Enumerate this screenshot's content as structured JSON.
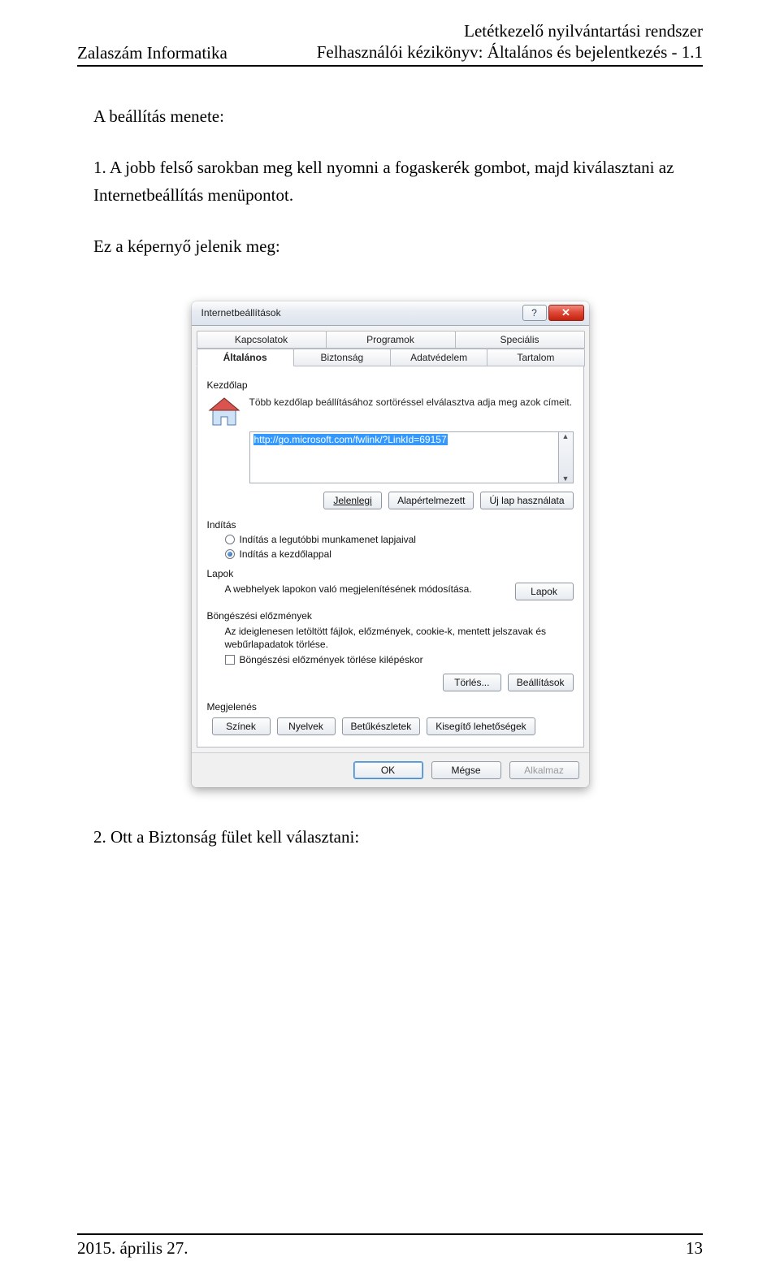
{
  "doc": {
    "header_left": "Zalaszám Informatika",
    "header_right_line1": "Letétkezelő nyilvántartási rendszer",
    "header_right_line2": "Felhasználói kézikönyv: Általános és bejelentkezés - 1.1",
    "p1": "A beállítás menete:",
    "p2": "1. A jobb felső sarokban meg kell nyomni a fogaskerék gombot, majd kiválasztani az Internetbeállítás menüpontot.",
    "p3": "Ez a képernyő jelenik meg:",
    "p4": "2. Ott a Biztonság fület kell választani:",
    "footer_left": "2015. április 27.",
    "footer_right": "13"
  },
  "dialog": {
    "title": "Internetbeállítások",
    "help_btn": "?",
    "close_btn": "✕",
    "tabs_row1": [
      "Kapcsolatok",
      "Programok",
      "Speciális"
    ],
    "tabs_row2": [
      "Általános",
      "Biztonság",
      "Adatvédelem",
      "Tartalom"
    ],
    "active_tab": "Általános",
    "home": {
      "section": "Kezdőlap",
      "desc": "Több kezdőlap beállításához sortöréssel elválasztva adja meg azok címeit.",
      "url": "http://go.microsoft.com/fwlink/?LinkId=69157",
      "btn_current": "Jelenlegi",
      "btn_default": "Alapértelmezett",
      "btn_newtab": "Új lap használata"
    },
    "startup": {
      "section": "Indítás",
      "opt_last": "Indítás a legutóbbi munkamenet lapjaival",
      "opt_home": "Indítás a kezdőlappal",
      "selected": "opt_home"
    },
    "tabs_section": {
      "section": "Lapok",
      "desc": "A webhelyek lapokon való megjelenítésének módosítása.",
      "btn": "Lapok"
    },
    "history": {
      "section": "Böngészési előzmények",
      "desc": "Az ideiglenesen letöltött fájlok, előzmények, cookie-k, mentett jelszavak és webűrlapadatok törlése.",
      "chk": "Böngészési előzmények törlése kilépéskor",
      "btn_delete": "Törlés...",
      "btn_settings": "Beállítások"
    },
    "appearance": {
      "section": "Megjelenés",
      "btn_colors": "Színek",
      "btn_langs": "Nyelvek",
      "btn_fonts": "Betűkészletek",
      "btn_access": "Kisegítő lehetőségek"
    },
    "footer": {
      "ok": "OK",
      "cancel": "Mégse",
      "apply": "Alkalmaz"
    }
  }
}
